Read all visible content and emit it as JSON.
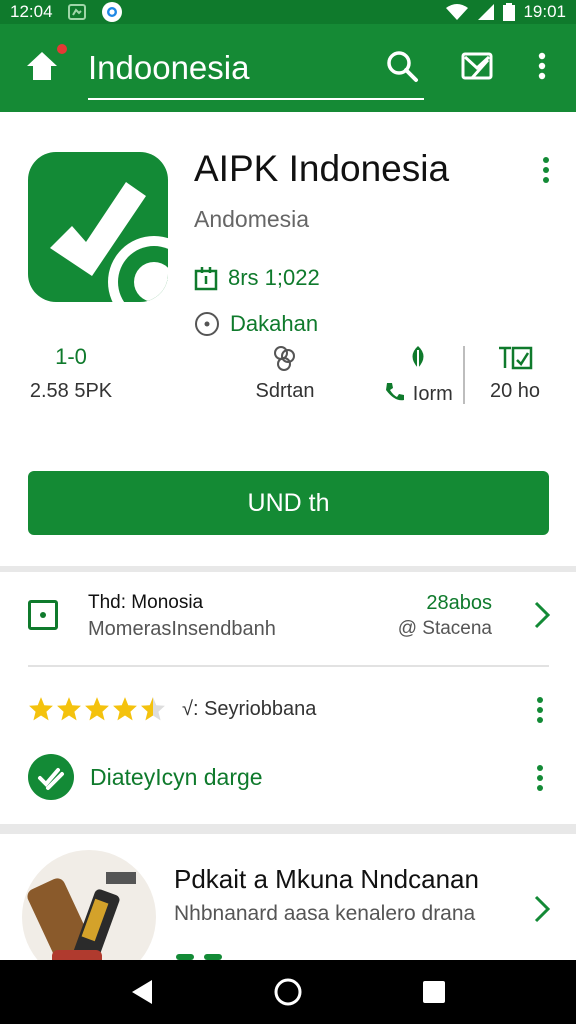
{
  "status_bar": {
    "time_left": "12:04",
    "time_right": "19:01",
    "icons": [
      "photo-icon",
      "recycle-icon",
      "chrome-icon",
      "wifi-icon",
      "signal-icon",
      "battery-icon"
    ]
  },
  "app_bar": {
    "title": "Indoonesia",
    "icons": [
      "home-icon",
      "search-icon",
      "share-icon",
      "overflow-menu-icon"
    ]
  },
  "header": {
    "app_name": "AIPK Indonesia",
    "developer": "Andomesia",
    "release_info": "8rs 1;022",
    "category": "Dakahan"
  },
  "stats": [
    {
      "top": "1-0",
      "bottom": "2.58 5PK",
      "icon": "chart-icon"
    },
    {
      "top": "",
      "bottom": "Sdrtan",
      "icon": "settings-icon"
    },
    {
      "top": "",
      "bottom": "Iorm",
      "icon": "phone-icon"
    },
    {
      "top": "T̲",
      "bottom": "20 ho",
      "icon": "tag-icon"
    }
  ],
  "install_button": "UND th",
  "info_row": {
    "title": "Thd: Monosia",
    "subtitle": "MomerasInsendbanh",
    "count": "28abos",
    "link": "@ Stacena"
  },
  "rating_row": {
    "rating": 4.5,
    "label": "√: Seyriobbana"
  },
  "feature_row": {
    "text": "DiateyIcyn darge"
  },
  "promo": {
    "title": "Pdkait a Mkuna Nndcanan",
    "subtitle": "Nhbnanard aasa kenalero drana"
  },
  "colors": {
    "primary": "#158a35",
    "primary_dark": "#0f7a2c",
    "star": "#f4c20d"
  },
  "nav_bar": {
    "icons": [
      "back-icon",
      "home-circle-icon",
      "recents-icon"
    ]
  }
}
